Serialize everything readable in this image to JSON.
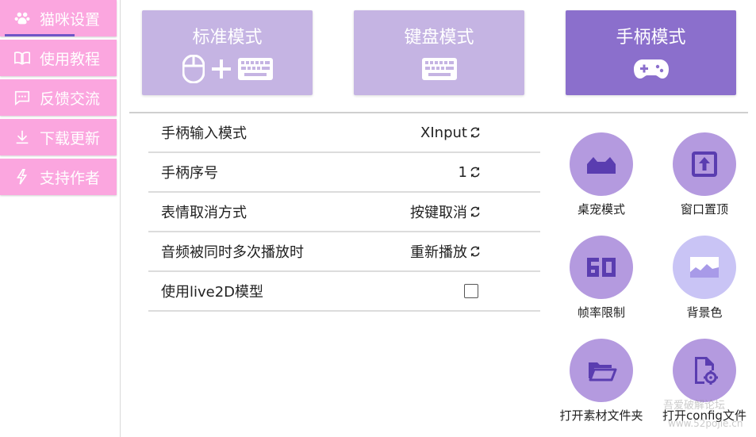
{
  "sidebar": {
    "items": [
      {
        "label": "猫咪设置",
        "icon": "paw-group-icon",
        "active": true
      },
      {
        "label": "使用教程",
        "icon": "book-open-icon",
        "active": false
      },
      {
        "label": "反馈交流",
        "icon": "chat-icon",
        "active": false
      },
      {
        "label": "下载更新",
        "icon": "download-icon",
        "active": false
      },
      {
        "label": "支持作者",
        "icon": "lightning-icon",
        "active": false
      }
    ]
  },
  "modes": [
    {
      "label": "标准模式",
      "icon": "mouse-plus-keyboard-icon",
      "selected": false
    },
    {
      "label": "键盘模式",
      "icon": "keyboard-icon",
      "selected": false
    },
    {
      "label": "手柄模式",
      "icon": "gamepad-icon",
      "selected": true
    }
  ],
  "settings": [
    {
      "label": "手柄输入模式",
      "value": "XInput"
    },
    {
      "label": "手柄序号",
      "value": "1"
    },
    {
      "label": "表情取消方式",
      "value": "按键取消"
    },
    {
      "label": "音频被同时多次播放时",
      "value": "重新播放"
    },
    {
      "label": "使用live2D模型",
      "checked": false
    }
  ],
  "tools": [
    {
      "label": "桌宠模式",
      "icon": "cat-ears-icon"
    },
    {
      "label": "窗口置顶",
      "icon": "pin-top-icon"
    },
    {
      "label": "帧率限制",
      "icon": "fps-60-icon"
    },
    {
      "label": "背景色",
      "icon": "image-landscape-icon"
    },
    {
      "label": "打开素材文件夹",
      "icon": "folder-open-icon"
    },
    {
      "label": "打开config文件",
      "icon": "file-settings-icon"
    }
  ],
  "watermark": {
    "text": "吾爱破解论坛",
    "url_text": "www.52pojie.cn"
  },
  "colors": {
    "nav_pink": "#fba6df",
    "mode_light": "#c5b4e3",
    "mode_selected": "#8b6fcc",
    "tool_purple": "#b49adf",
    "icon_dark": "#5a3db0"
  }
}
